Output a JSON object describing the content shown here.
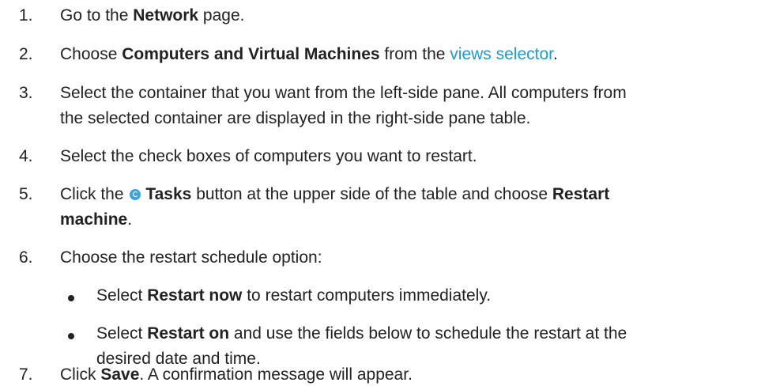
{
  "steps": [
    {
      "num": "1.",
      "pre": "Go to the ",
      "b1": "Network",
      "post": " page."
    },
    {
      "num": "2.",
      "pre": "Choose ",
      "b1": "Computers and Virtual Machines",
      "mid": " from the ",
      "link": "views selector",
      "post": "."
    },
    {
      "num": "3.",
      "line1": "Select the container that you want from the left-side pane. All computers from",
      "line2": "the selected container are displayed in the right-side pane table."
    },
    {
      "num": "4.",
      "text": "Select the check boxes of computers you want to restart."
    },
    {
      "num": "5.",
      "pre": "Click the ",
      "icon": "tasks-icon",
      "b1": "Tasks",
      "mid": " button at the upper side of the table and choose ",
      "b2": "Restart",
      "b3": "machine",
      "post": "."
    },
    {
      "num": "6.",
      "text": "Choose the restart schedule option:",
      "sub": [
        {
          "pre": "Select ",
          "b": "Restart now",
          "post": " to restart computers immediately."
        },
        {
          "pre": "Select ",
          "b": "Restart on",
          "post1": " and use the fields below to schedule the restart at the",
          "post2": "desired date and time."
        }
      ]
    },
    {
      "num": "7.",
      "pre": "Click ",
      "b1": "Save",
      "post": ". A confirmation message will appear."
    }
  ],
  "colors": {
    "text": "#222222",
    "link": "#1a9bd7",
    "icon": "#3aa6e0"
  }
}
